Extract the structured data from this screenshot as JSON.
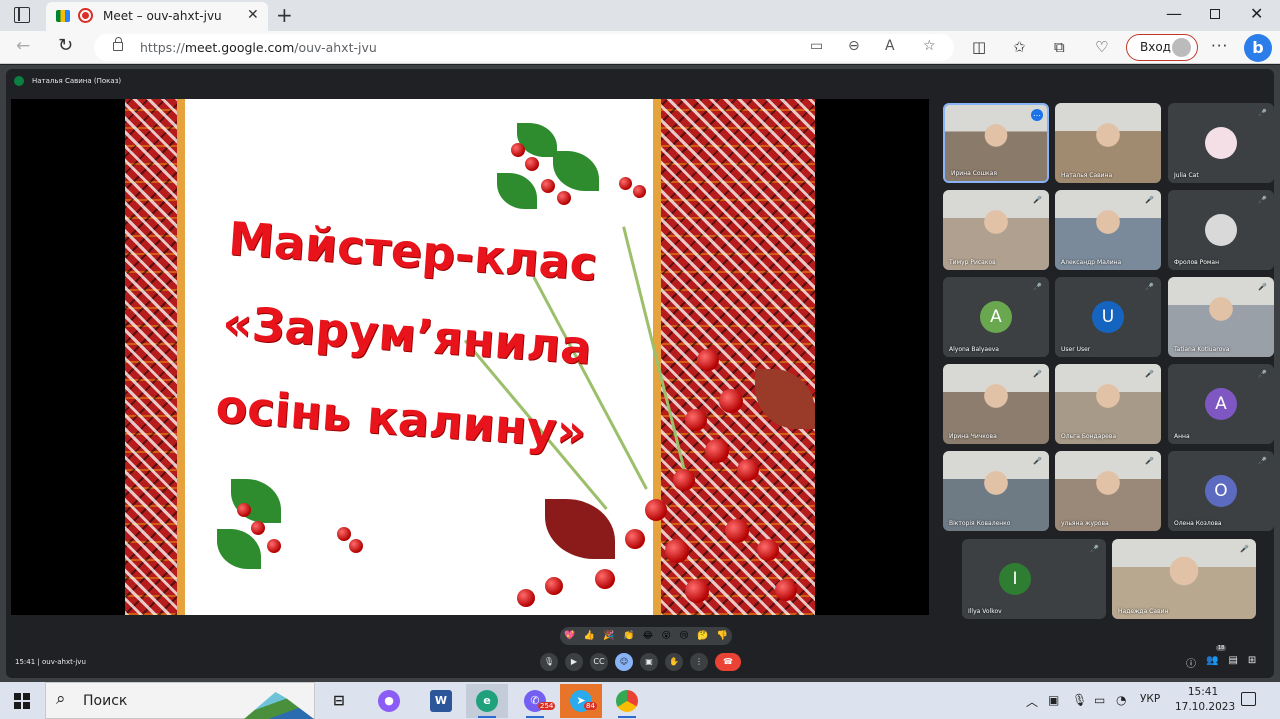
{
  "browser": {
    "tab_title": "Meet – ouv-ahxt-jvu",
    "url_prefix": "https://",
    "url_host": "meet.google.com",
    "url_path": "/ouv-ahxt-jvu",
    "signin_label": "Вход",
    "close_glyph": "✕",
    "new_tab_glyph": "+"
  },
  "meet": {
    "presenter_label": "Наталья Савина (Показ)",
    "meeting_time": "15:41",
    "meeting_code": "ouv-ahxt-jvu",
    "participant_count": "18",
    "reactions": [
      "💖",
      "👍",
      "🎉",
      "👏",
      "😂",
      "😮",
      "😢",
      "🤔",
      "👎"
    ]
  },
  "slide": {
    "title_line1": "Майстер-клас",
    "title_line2": "«Зарум’янила",
    "title_line3": "осінь калину»"
  },
  "participants": [
    {
      "name": "Ирина Сошкая",
      "kind": "video"
    },
    {
      "name": "Наталья Савина",
      "kind": "video"
    },
    {
      "name": "Julia Cat",
      "kind": "avatar-image"
    },
    {
      "name": "Тимур Рисаков",
      "kind": "video"
    },
    {
      "name": "Александр Малина",
      "kind": "video"
    },
    {
      "name": "Фролов Роман",
      "kind": "avatar-image"
    },
    {
      "name": "Alyona Balyaeva",
      "kind": "letter",
      "letter": "A",
      "color": "#6aa84f"
    },
    {
      "name": "User User",
      "kind": "letter",
      "letter": "U",
      "color": "#1565c0"
    },
    {
      "name": "Tatiana Kotluarova",
      "kind": "video"
    },
    {
      "name": "Ирина Чичкова",
      "kind": "video"
    },
    {
      "name": "Ольга Бондарева",
      "kind": "video"
    },
    {
      "name": "Анна",
      "kind": "letter",
      "letter": "A",
      "color": "#7e57c2"
    },
    {
      "name": "Вікторія Коваленко",
      "kind": "video"
    },
    {
      "name": "ульяна журова",
      "kind": "video"
    },
    {
      "name": "Олена Козлова",
      "kind": "letter",
      "letter": "O",
      "color": "#5c6bc0"
    },
    {
      "name": "Illya Volkov",
      "kind": "letter",
      "letter": "I",
      "color": "#2e7d32"
    },
    {
      "name": "Надежда Савин",
      "kind": "video"
    }
  ],
  "taskbar": {
    "search_label": "Поиск",
    "viber_badge": "254",
    "telegram_badge": "84",
    "language": "УКР",
    "time": "15:41",
    "date": "17.10.2023"
  }
}
